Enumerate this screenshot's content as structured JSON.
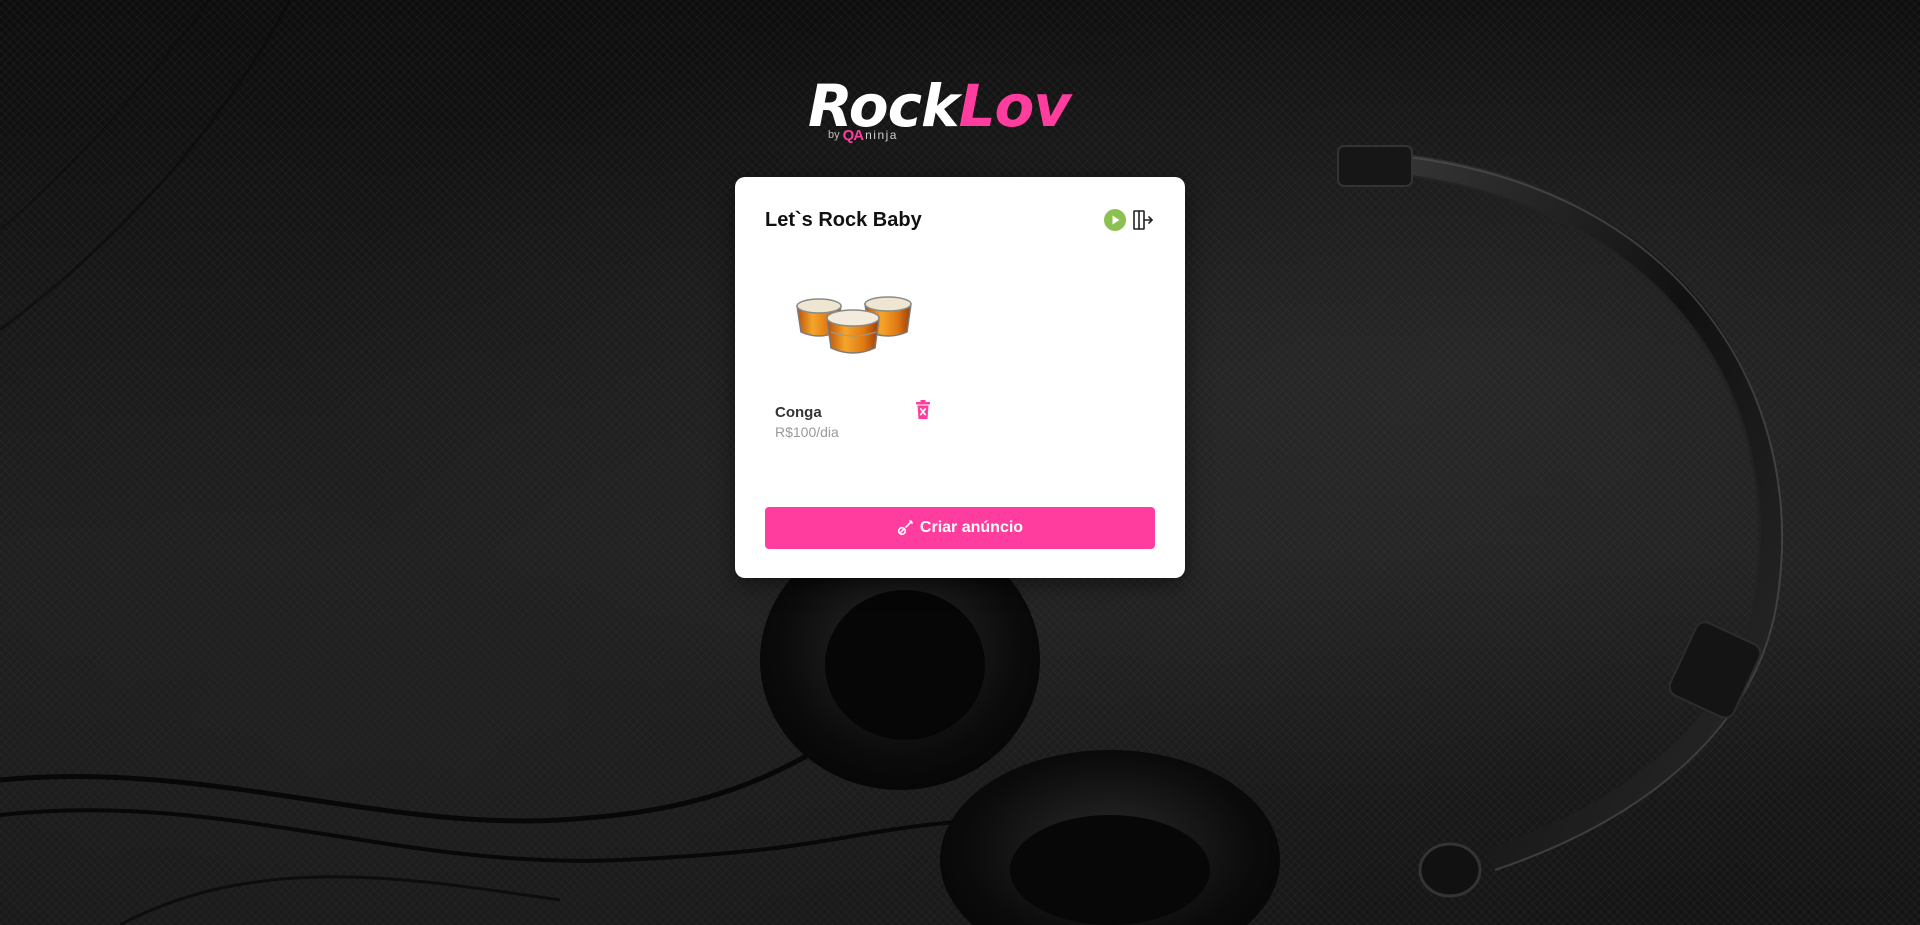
{
  "logo": {
    "part1": "Rock",
    "part2": "Lov",
    "by": "by",
    "qa": "QA",
    "ninja": "ninja"
  },
  "dashboard": {
    "title": "Let`s Rock Baby",
    "icons": [
      "play-circle-icon",
      "logout-icon"
    ]
  },
  "listings": [
    {
      "name": "Conga",
      "price": "R$100/dia",
      "image_icon": "conga-drums-image",
      "delete_icon": "trash-icon"
    }
  ],
  "create_button": {
    "label": "Criar anúncio",
    "icon": "guitar-icon"
  },
  "colors": {
    "accent": "#ff3d9e",
    "play_green": "#8cc152",
    "card_bg": "#ffffff",
    "background": "#121212",
    "price_gray": "#9a9a9a"
  }
}
